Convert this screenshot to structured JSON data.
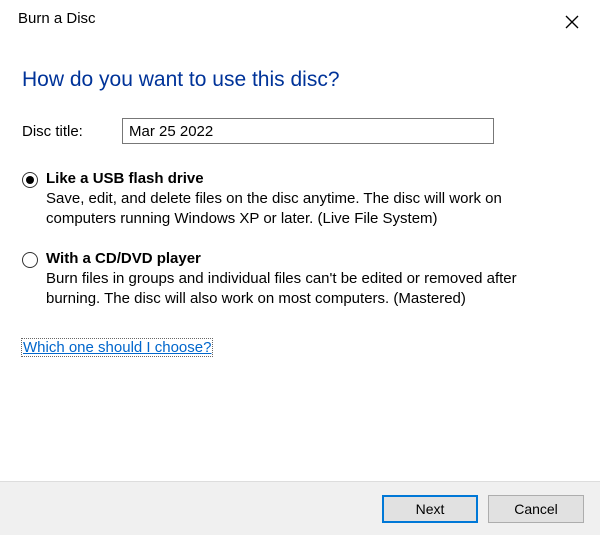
{
  "window": {
    "title": "Burn a Disc"
  },
  "heading": "How do you want to use this disc?",
  "disc_title": {
    "label": "Disc title:",
    "value": "Mar 25 2022"
  },
  "options": [
    {
      "id": "usb",
      "title": "Like a USB flash drive",
      "description": "Save, edit, and delete files on the disc anytime. The disc will work on computers running Windows XP or later. (Live File System)",
      "selected": true
    },
    {
      "id": "cddvd",
      "title": "With a CD/DVD player",
      "description": "Burn files in groups and individual files can't be edited or removed after burning. The disc will also work on most computers. (Mastered)",
      "selected": false
    }
  ],
  "help_link": "Which one should I choose?",
  "buttons": {
    "next": "Next",
    "cancel": "Cancel"
  }
}
